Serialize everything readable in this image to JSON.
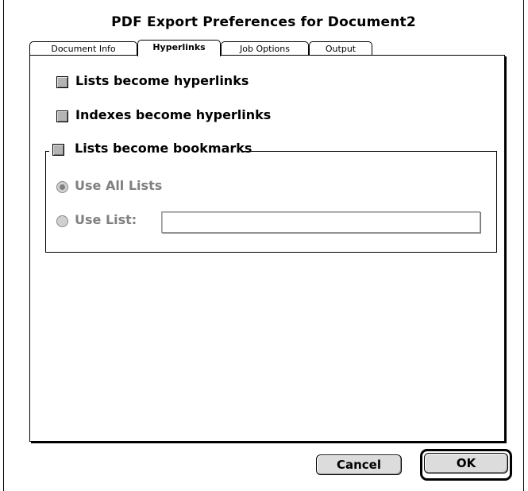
{
  "dialog": {
    "title": "PDF Export Preferences for Document2"
  },
  "tabs": [
    {
      "label": "Document Info",
      "active": false
    },
    {
      "label": "Hyperlinks",
      "active": true
    },
    {
      "label": "Job Options",
      "active": false
    },
    {
      "label": "Output",
      "active": false
    }
  ],
  "options": {
    "lists_hyperlinks": {
      "label": "Lists become hyperlinks",
      "checked": false
    },
    "indexes_hyperlinks": {
      "label": "Indexes become hyperlinks",
      "checked": false
    },
    "lists_bookmarks": {
      "label": "Lists become bookmarks",
      "checked": false
    }
  },
  "bookmarks_group": {
    "use_all_lists": {
      "label": "Use All Lists",
      "selected": true,
      "enabled": false
    },
    "use_list": {
      "label": "Use List:",
      "selected": false,
      "enabled": false,
      "value": ""
    }
  },
  "buttons": {
    "cancel": "Cancel",
    "ok": "OK"
  }
}
